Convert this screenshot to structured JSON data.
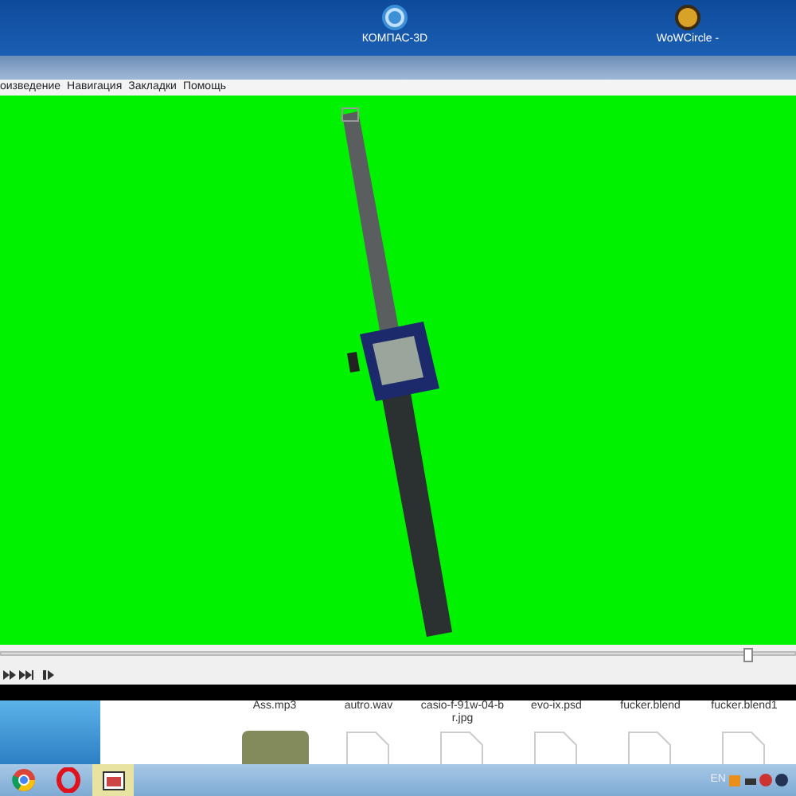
{
  "desktop_icons": [
    {
      "label": "КОМПАС-3D",
      "kind": "kompas"
    },
    {
      "label": "WoWCircle -",
      "kind": "wow"
    }
  ],
  "player": {
    "menu": [
      "оизведение",
      "Навигация",
      "Закладки",
      "Помощь"
    ],
    "seek": {
      "level": 0.94
    }
  },
  "explorer": {
    "files": [
      {
        "name": "Ass.mp3",
        "kind": "thumb"
      },
      {
        "name": "autro.wav",
        "kind": "doc"
      },
      {
        "name": "casio-f-91w-04-b r.jpg",
        "kind": "doc"
      },
      {
        "name": "evo-ix.psd",
        "kind": "doc"
      },
      {
        "name": "fucker.blend",
        "kind": "doc"
      },
      {
        "name": "fucker.blend1",
        "kind": "doc"
      }
    ]
  },
  "taskbar": {
    "apps": [
      {
        "kind": "chrome",
        "selected": false
      },
      {
        "kind": "opera",
        "selected": false
      },
      {
        "kind": "media",
        "selected": true
      }
    ],
    "language": "EN"
  }
}
